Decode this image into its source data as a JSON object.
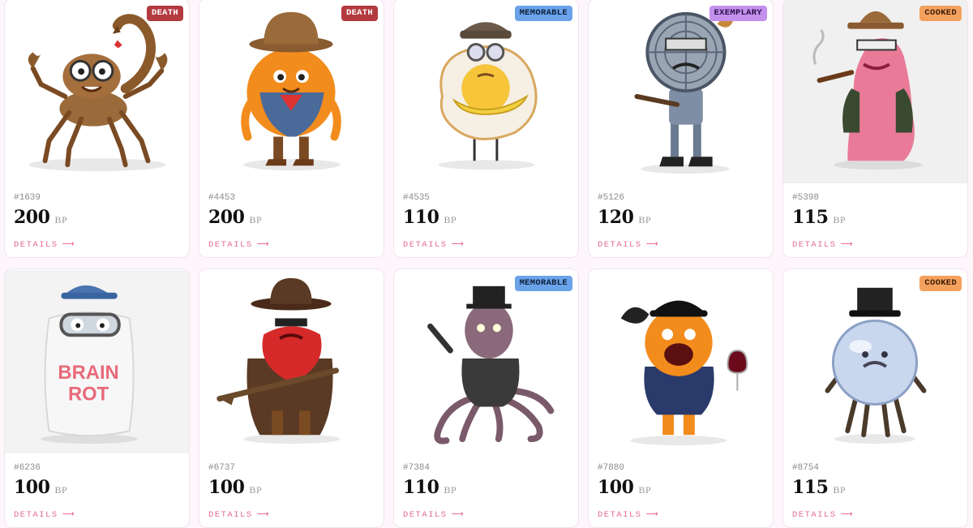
{
  "cards": [
    {
      "id": "#1639",
      "price": "200",
      "unit": "BP",
      "details": "DETAILS",
      "arrow": "⟶",
      "badge": "DEATH",
      "subject": "scorpion-with-glasses",
      "bg": "#ffffff"
    },
    {
      "id": "#4453",
      "price": "200",
      "unit": "BP",
      "details": "DETAILS",
      "arrow": "⟶",
      "badge": "DEATH",
      "subject": "orange-cowboy",
      "bg": "#ffffff"
    },
    {
      "id": "#4535",
      "price": "110",
      "unit": "BP",
      "details": "DETAILS",
      "arrow": "⟶",
      "badge": "MEMORABLE",
      "subject": "fried-egg-with-bananas",
      "bg": "#ffffff"
    },
    {
      "id": "#5126",
      "price": "120",
      "unit": "BP",
      "details": "DETAILS",
      "arrow": "⟶",
      "badge": "EXEMPLARY",
      "subject": "electric-fan-robot",
      "bg": "#ffffff"
    },
    {
      "id": "#5398",
      "price": "115",
      "unit": "BP",
      "details": "DETAILS",
      "arrow": "⟶",
      "badge": "COOKED",
      "subject": "pink-sausage-with-cigar",
      "bg": "#f0f0f0"
    },
    {
      "id": "#6236",
      "price": "100",
      "unit": "BP",
      "details": "DETAILS",
      "arrow": "⟶",
      "badge": "",
      "subject": "pillow-brain-rot",
      "bg": "#f3f3f3",
      "shirt_text_1": "BRAIN",
      "shirt_text_2": "ROT"
    },
    {
      "id": "#6737",
      "price": "100",
      "unit": "BP",
      "details": "DETAILS",
      "arrow": "⟶",
      "badge": "",
      "subject": "strawberry-gunslinger",
      "bg": "#ffffff"
    },
    {
      "id": "#7384",
      "price": "110",
      "unit": "BP",
      "details": "DETAILS",
      "arrow": "⟶",
      "badge": "MEMORABLE",
      "subject": "octopus-gentleman",
      "bg": "#ffffff"
    },
    {
      "id": "#7880",
      "price": "100",
      "unit": "BP",
      "details": "DETAILS",
      "arrow": "⟶",
      "badge": "",
      "subject": "orange-with-crow-and-wine",
      "bg": "#ffffff"
    },
    {
      "id": "#8754",
      "price": "115",
      "unit": "BP",
      "details": "DETAILS",
      "arrow": "⟶",
      "badge": "COOKED",
      "subject": "crystal-ball-top-hat",
      "bg": "#ffffff"
    }
  ]
}
